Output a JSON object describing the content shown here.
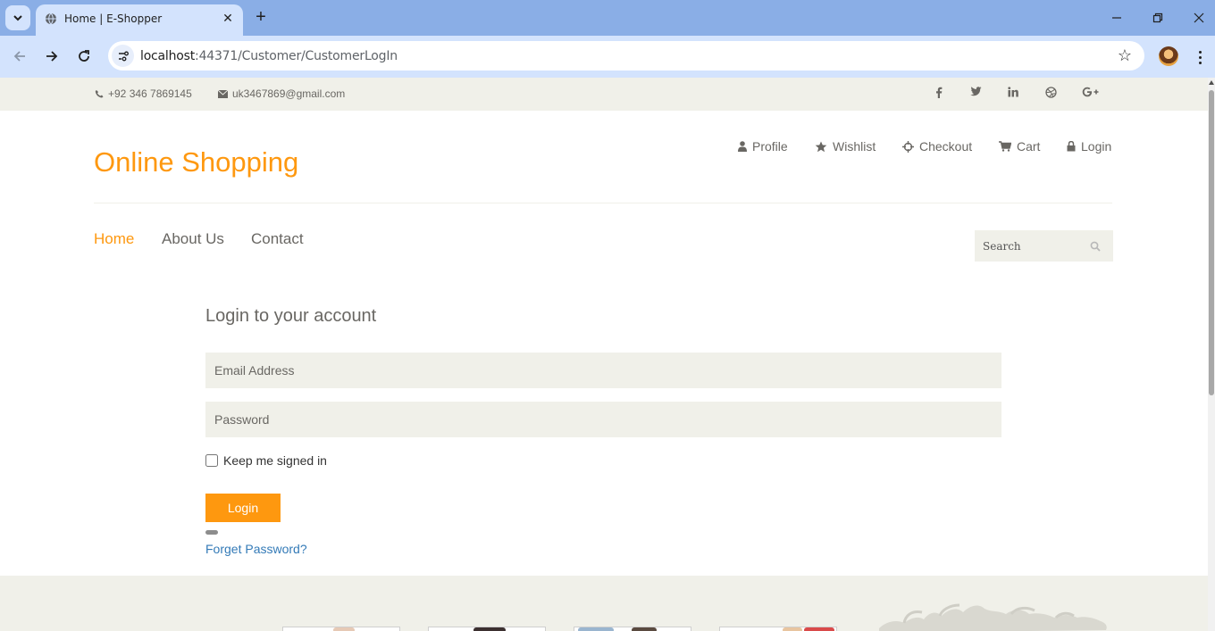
{
  "browser": {
    "tab_title": "Home | E-Shopper",
    "url_host": "localhost",
    "url_path": ":44371/Customer/CustomerLogIn"
  },
  "topbar": {
    "phone": "+92 346 7869145",
    "email": "uk3467869@gmail.com",
    "social_icons": [
      "facebook-icon",
      "twitter-icon",
      "linkedin-icon",
      "dribbble-icon",
      "google-plus-icon"
    ]
  },
  "header": {
    "logo": "Online Shopping",
    "account_nav": [
      {
        "label": "Profile",
        "icon": "user-icon"
      },
      {
        "label": "Wishlist",
        "icon": "star-icon"
      },
      {
        "label": "Checkout",
        "icon": "crosshairs-icon"
      },
      {
        "label": "Cart",
        "icon": "cart-icon"
      },
      {
        "label": "Login",
        "icon": "lock-icon"
      }
    ]
  },
  "mainnav": {
    "items": [
      "Home",
      "About Us",
      "Contact"
    ],
    "active": "Home"
  },
  "search": {
    "placeholder": "Search"
  },
  "login": {
    "title": "Login to your account",
    "email_placeholder": "Email Address",
    "password_placeholder": "Password",
    "remember_label": "Keep me signed in",
    "button": "Login",
    "forgot": "Forget Password?"
  },
  "colors": {
    "accent": "#fe980f",
    "muted_bg": "#f0f0e9",
    "text": "#696763",
    "link": "#337ab7"
  }
}
